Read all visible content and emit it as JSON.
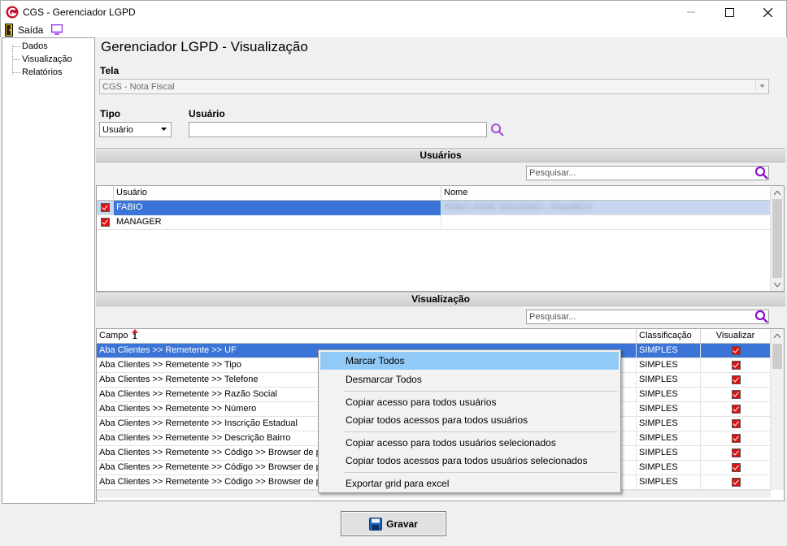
{
  "window": {
    "title": "CGS - Gerenciador LGPD"
  },
  "menu": {
    "exit_label": "Saída"
  },
  "tree": {
    "items": [
      "Dados",
      "Visualização",
      "Relatórios"
    ]
  },
  "main": {
    "title": "Gerenciador LGPD - Visualização",
    "tela_label": "Tela",
    "tela_value": "CGS - Nota Fiscal",
    "tipo_label": "Tipo",
    "tipo_value": "Usuário",
    "usuario_label": "Usuário",
    "usuario_value": ""
  },
  "users_section": {
    "title": "Usuários",
    "search_placeholder": "Pesquisar...",
    "columns": [
      "Usuário",
      "Nome"
    ],
    "rows": [
      {
        "user": "FABIO",
        "name": "FABIO JOSE SALVIANO - FinanBCO",
        "checked": true,
        "selected": true
      },
      {
        "user": "MANAGER",
        "name": "",
        "checked": true,
        "selected": false
      }
    ]
  },
  "view_section": {
    "title": "Visualização",
    "search_placeholder": "Pesquisar...",
    "columns": [
      "Campo",
      "Classificação",
      "Visualizar"
    ],
    "sort_badge": "1",
    "rows": [
      {
        "campo": "Aba Clientes >> Remetente >> UF",
        "class": "SIMPLES",
        "visualizar": true,
        "selected": true
      },
      {
        "campo": "Aba Clientes >> Remetente >> Tipo",
        "class": "SIMPLES",
        "visualizar": true
      },
      {
        "campo": "Aba Clientes >> Remetente >> Telefone",
        "class": "SIMPLES",
        "visualizar": true
      },
      {
        "campo": "Aba Clientes >> Remetente >> Razão Social",
        "class": "SIMPLES",
        "visualizar": true
      },
      {
        "campo": "Aba Clientes >> Remetente >> Número",
        "class": "SIMPLES",
        "visualizar": true
      },
      {
        "campo": "Aba Clientes >> Remetente >> Inscrição Estadual",
        "class": "SIMPLES",
        "visualizar": true
      },
      {
        "campo": "Aba Clientes >> Remetente >> Descrição Bairro",
        "class": "SIMPLES",
        "visualizar": true
      },
      {
        "campo": "Aba Clientes >> Remetente >> Código >> Browser de pesquisa",
        "class": "SIMPLES",
        "visualizar": true
      },
      {
        "campo": "Aba Clientes >> Remetente >> Código >> Browser de pesquisa",
        "class": "SIMPLES",
        "visualizar": true
      },
      {
        "campo": "Aba Clientes >> Remetente >> Código >> Browser de pesquisa",
        "class": "SIMPLES",
        "visualizar": true
      }
    ]
  },
  "context_menu": {
    "items": [
      "Marcar Todos",
      "Desmarcar Todos",
      "Copiar acesso para todos usuários",
      "Copiar todos acessos para todos usuários",
      "Copiar acesso para todos usuários selecionados",
      "Copiar todos acessos para todos usuários selecionados",
      "Exportar grid para excel"
    ]
  },
  "footer": {
    "save_label": "Gravar"
  },
  "colors": {
    "selection": "#3a74d6",
    "menu_hover": "#91c9f7",
    "logo_red": "#c8102e",
    "checkbox_red": "#d11111"
  }
}
